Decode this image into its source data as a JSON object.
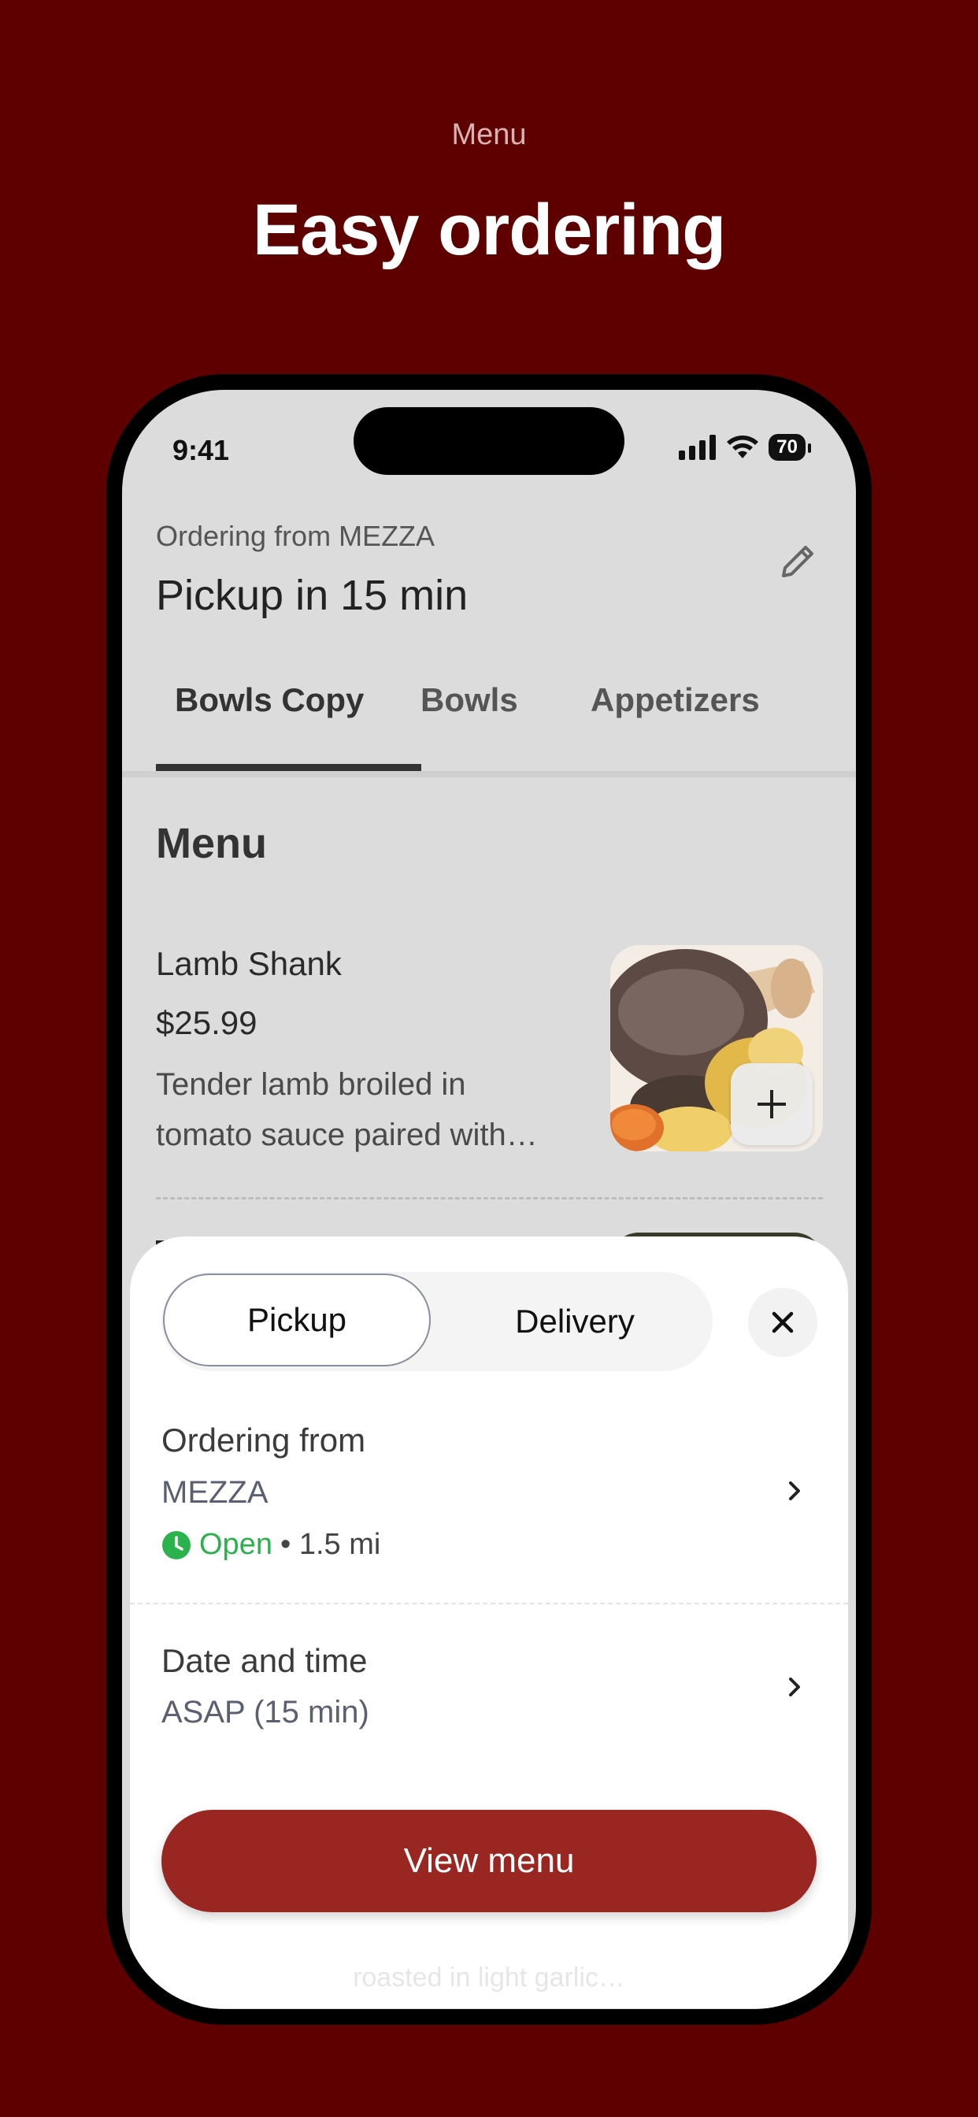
{
  "page": {
    "eyebrow": "Menu",
    "headline": "Easy ordering"
  },
  "status_bar": {
    "time": "9:41",
    "battery": "70"
  },
  "header": {
    "ordering_from_line": "Ordering from MEZZA",
    "pickup_eta": "Pickup in 15 min"
  },
  "tabs": [
    {
      "label": "Bowls Copy",
      "active": true
    },
    {
      "label": "Bowls",
      "active": false
    },
    {
      "label": "Appetizers",
      "active": false
    }
  ],
  "menu": {
    "heading": "Menu",
    "items": [
      {
        "name": "Lamb Shank",
        "price": "$25.99",
        "description": "Tender lamb broiled in tomato sauce paired with…"
      }
    ],
    "peek_text": "roasted in light garlic…"
  },
  "sheet": {
    "mode_options": [
      "Pickup",
      "Delivery"
    ],
    "selected_mode": "Pickup",
    "ordering_from_label": "Ordering from",
    "location_name": "MEZZA",
    "open_status": "Open",
    "distance": "• 1.5 mi",
    "date_time_label": "Date and time",
    "date_time_value": "ASAP (15 min)",
    "cta_label": "View menu"
  },
  "colors": {
    "background": "#5e0000",
    "accent": "#992621",
    "open_green": "#2bb24c"
  }
}
